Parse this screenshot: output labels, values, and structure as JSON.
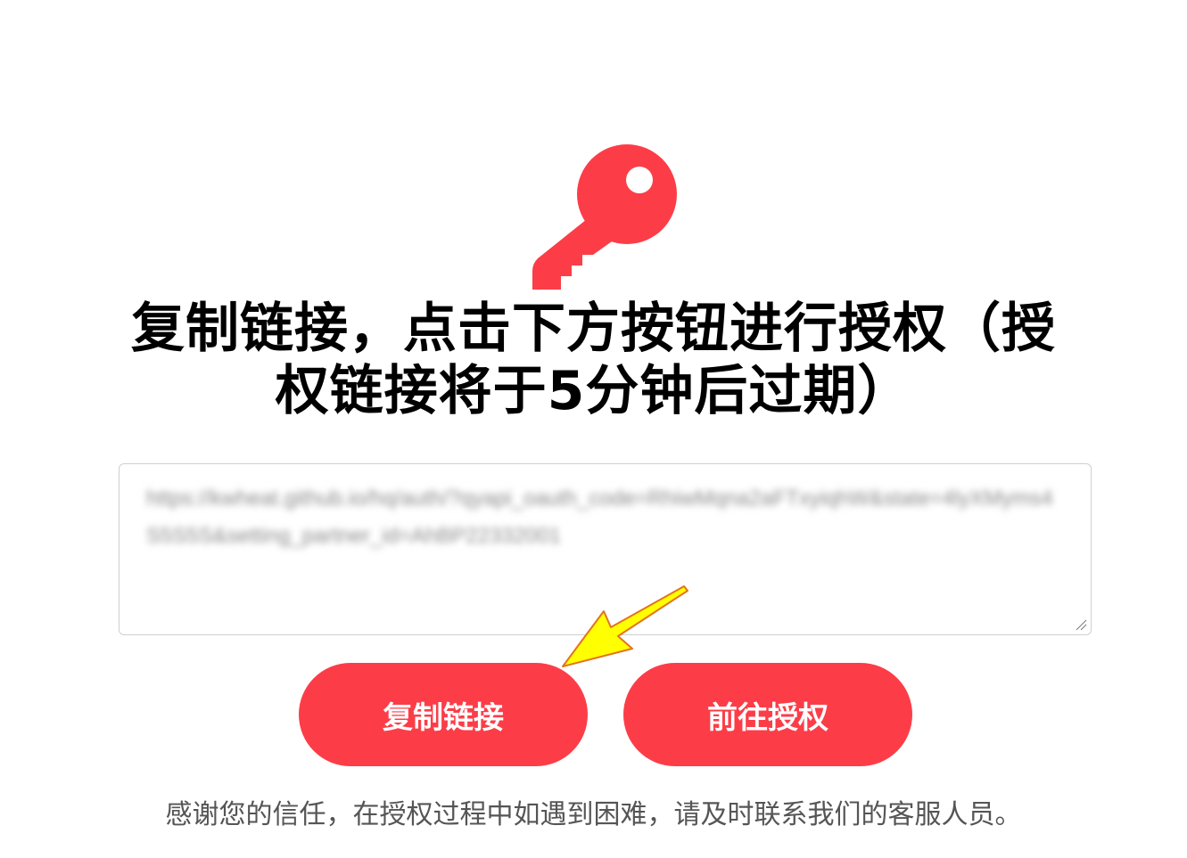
{
  "icon": "key-icon",
  "colors": {
    "accent": "#fc3d48",
    "arrow": "#ffff00"
  },
  "title": "复制链接，点击下方按钮进行授权（授权链接将于5分钟后过期）",
  "link_box": {
    "value": "https://kwheat.github.io/hq/auth/?qyapi_oauth_code=RhiwMqna2aFTxyiqhW&state=4lyXMyms4S5S5S&setting_partner_id=AhBP22332001"
  },
  "buttons": {
    "copy_label": "复制链接",
    "authorize_label": "前往授权"
  },
  "footer": "感谢您的信任，在授权过程中如遇到困难，请及时联系我们的客服人员。"
}
